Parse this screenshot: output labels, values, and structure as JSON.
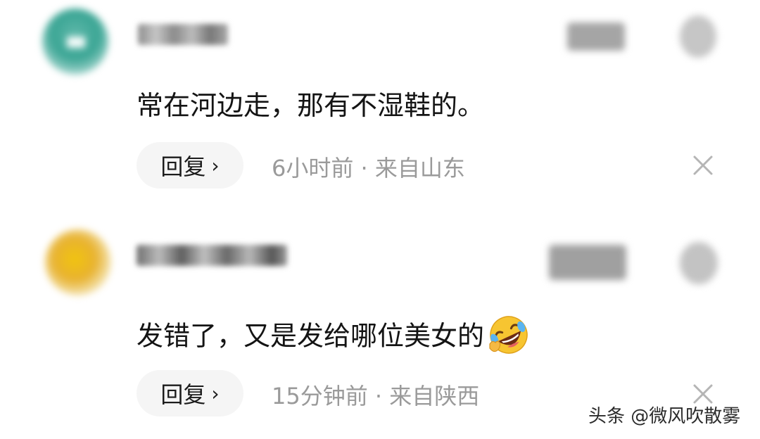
{
  "comments": [
    {
      "text": "常在河边走，那有不湿鞋的。",
      "reply_label": "回复",
      "reply_chevron": "›",
      "time": "6小时前",
      "separator": "·",
      "location": "来自山东",
      "avatar_color": "#3aa594"
    },
    {
      "text": "发错了，又是发给哪位美女的",
      "emoji": "rolling-on-floor-laughing-emoji",
      "reply_label": "回复",
      "reply_chevron": "›",
      "time": "15分钟前",
      "separator": "·",
      "location": "来自陕西",
      "avatar_color": "#e8b230"
    }
  ],
  "watermark": "头条 @微风吹散雾",
  "colors": {
    "text": "#141414",
    "meta": "#9a9a9a",
    "reply_bg": "#f5f5f5",
    "close": "#b5b5b5"
  }
}
